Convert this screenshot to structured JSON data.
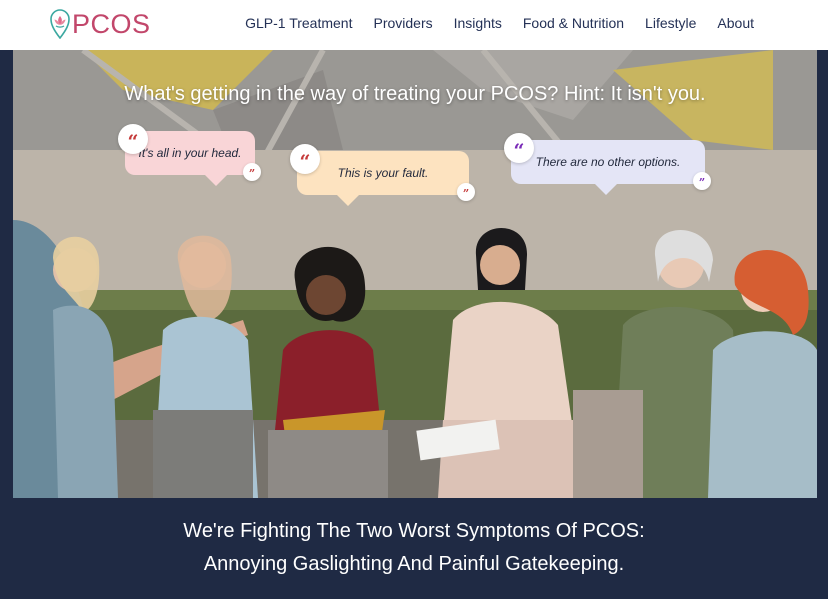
{
  "header": {
    "logo_text": "PCOS",
    "nav": [
      "GLP-1 Treatment",
      "Providers",
      "Insights",
      "Food & Nutrition",
      "Lifestyle",
      "About"
    ]
  },
  "hero": {
    "headline": "What's getting in the way of treating your PCOS? Hint: It isn't you.",
    "bubbles": [
      {
        "text": "It's all in your head.",
        "color": "#f9d5d7",
        "quote_color": "#c53a3a"
      },
      {
        "text": "This is your fault.",
        "color": "#fde3c0",
        "quote_color": "#c53a3a"
      },
      {
        "text": "There are no other options.",
        "color": "#e4e5f6",
        "quote_color": "#7a2bb8"
      }
    ],
    "quote_open": "“",
    "quote_close": "”",
    "image_description_icon": "group-therapy-photo"
  },
  "tagline": {
    "line1": "We're Fighting The Two Worst Symptoms Of PCOS:",
    "line2": "Annoying Gaslighting And Painful Gatekeeping."
  },
  "colors": {
    "brand": "#c2476b",
    "nav_text": "#243156",
    "band": "#1f2a44"
  }
}
